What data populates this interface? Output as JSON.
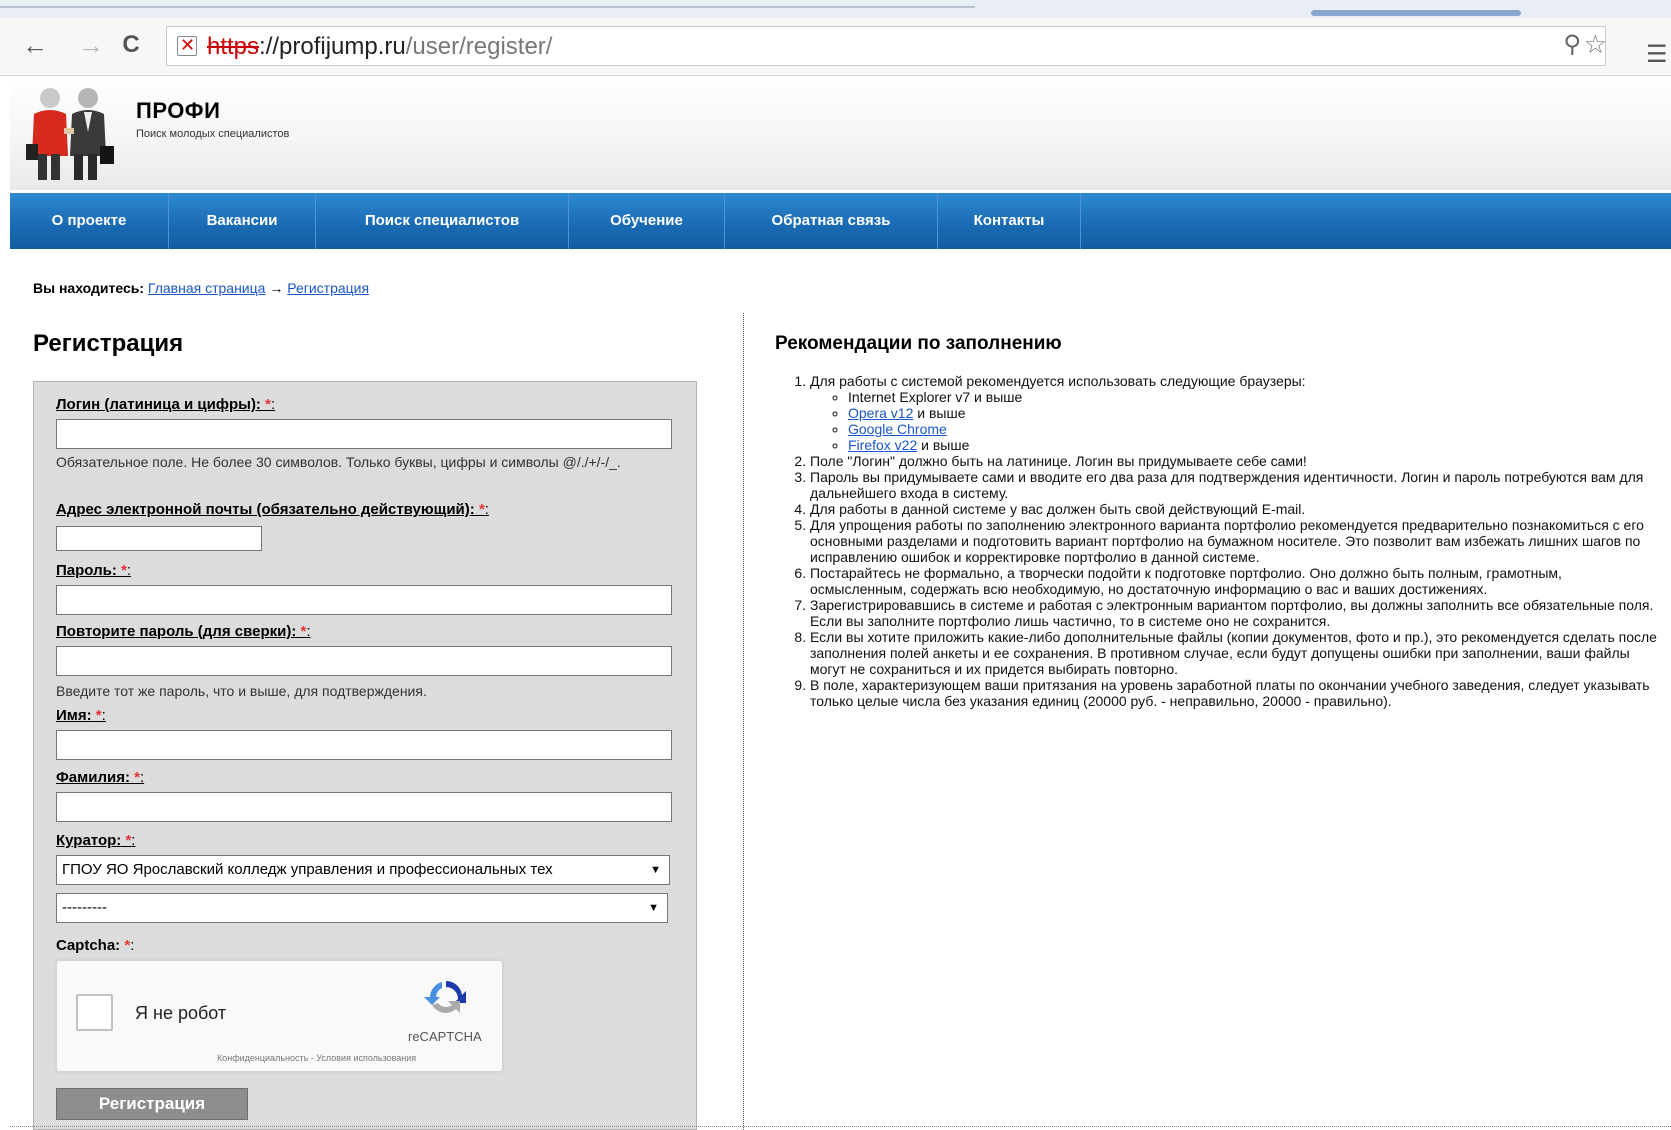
{
  "browser": {
    "url_scheme": "https",
    "url_host": "://profijump.ru",
    "url_path": "/user/register/",
    "back_icon": "←",
    "forward_icon": "→",
    "reload_icon": "C",
    "zoom_icon": "⚲",
    "star_icon": "☆",
    "menu_icon": "☰"
  },
  "site": {
    "title": "ПРОФИ",
    "subtitle": "Поиск молодых специалистов"
  },
  "nav": {
    "items": [
      "О проекте",
      "Вакансии",
      "Поиск специалистов",
      "Обучение",
      "Обратная связь",
      "Контакты"
    ]
  },
  "breadcrumb": {
    "prefix": "Вы находитесь:",
    "home": "Главная страница",
    "separator": "→",
    "current": "Регистрация"
  },
  "form": {
    "title": "Регистрация",
    "required_mark": "*",
    "login_label": "Логин (латиница и цифры):",
    "login_help": "Обязательное поле. Не более 30 символов. Только буквы, цифры и символы @/./+/-/_.",
    "email_label": "Адрес электронной почты (обязательно действующий):",
    "password_label": "Пароль:",
    "password2_label": "Повторите пароль (для сверки):",
    "password2_help": "Введите тот же пароль, что и выше, для подтверждения.",
    "first_name_label": "Имя:",
    "last_name_label": "Фамилия:",
    "curator_label": "Куратор:",
    "curator_value": "ГПОУ ЯО Ярославский колледж управления и профессиональных тех",
    "second_select_value": "---------",
    "captcha_label": "Captcha:",
    "captcha_text": "Я не робот",
    "captcha_brand": "reCAPTCHA",
    "captcha_links": "Конфиденциальность - Условия использования",
    "submit_label": "Регистрация"
  },
  "recommendations": {
    "title": "Рекомендации по заполнению",
    "item1": "Для работы с системой рекомендуется использовать следующие браузеры:",
    "browsers": {
      "ie": "Internet Explorer v7 и выше",
      "opera_link": "Opera v12",
      "opera_suffix": " и выше",
      "chrome_link": "Google Chrome",
      "firefox_link": "Firefox v22",
      "firefox_suffix": " и выше"
    },
    "item2": "Поле \"Логин\" должно быть на латинице. Логин вы придумываете себе сами!",
    "item3": "Пароль вы придумываете сами и вводите его два раза для подтверждения идентичности. Логин и пароль потребуются вам для дальнейшего входа в систему.",
    "item4": "Для работы в данной системе у вас должен быть свой действующий E-mail.",
    "item5": "Для упрощения работы по заполнению электронного варианта портфолио рекомендуется предварительно познакомиться с его основными разделами и подготовить вариант портфолио на бумажном носителе. Это позволит вам избежать лишних шагов по исправлению ошибок и корректировке портфолио в данной системе.",
    "item6": "Постарайтесь не формально, а творчески подойти к подготовке портфолио. Оно должно быть полным, грамотным, осмысленным, содержать всю необходимую, но достаточную информацию о вас и ваших достижениях.",
    "item7": "Зарегистрировавшись в системе и работая с электронным вариантом портфолио, вы должны заполнить все обязательные поля. Если вы заполните портфолио лишь частично, то в системе оно не сохранится.",
    "item8": "Если вы хотите приложить какие-либо дополнительные файлы (копии документов, фото и пр.), это рекомендуется сделать после заполнения полей анкеты и ее сохранения. В противном случае, если будут допущены ошибки при заполнении, ваши файлы могут не сохраниться и их придется выбирать повторно.",
    "item9": "В поле, характеризующем ваши притязания на уровень заработной платы по окончании учебного заведения, следует указывать только целые числа без указания единиц (20000 руб. - неправильно, 20000 - правильно)."
  },
  "colors": {
    "nav_blue": "#1a6cb5",
    "link": "#1a55c9",
    "required": "#e53333",
    "form_bg": "#dcdcdc"
  }
}
